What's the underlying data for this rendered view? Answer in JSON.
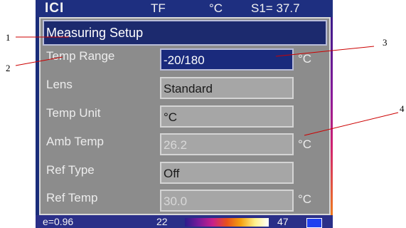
{
  "status_bar": {
    "logo": "ICI",
    "mode": "TF",
    "unit": "°C",
    "spot": "S1= 37.7"
  },
  "dialog": {
    "title": "Measuring Setup",
    "rows": [
      {
        "label": "Temp Range",
        "value": "-20/180",
        "unit": "°C",
        "selected": true
      },
      {
        "label": "Lens",
        "value": "Standard",
        "unit": ""
      },
      {
        "label": "Temp Unit",
        "value": "°C",
        "unit": ""
      },
      {
        "label": "Amb Temp",
        "value": "26.2",
        "unit": "°C",
        "dimmed": true
      },
      {
        "label": "Ref Type",
        "value": "Off",
        "unit": ""
      },
      {
        "label": "Ref Temp",
        "value": "30.0",
        "unit": "°C",
        "dimmed": true
      }
    ]
  },
  "bottom_bar": {
    "emissivity": "e=0.96",
    "min_temp": "22",
    "max_temp": "47"
  },
  "callouts": [
    "1",
    "2",
    "3",
    "4"
  ],
  "colors": {
    "screen_bg": "#1a2d7a",
    "dialog_bg": "#8c8c8c",
    "selected_field": "#1a2a7c"
  }
}
